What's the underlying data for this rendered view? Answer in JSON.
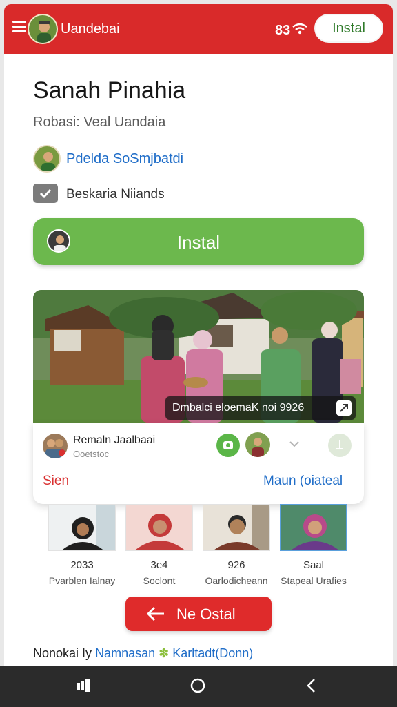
{
  "header": {
    "app_name": "Uandebai",
    "status_text": "83",
    "install_label": "Instal",
    "icons": {
      "menu": "hamburger-icon",
      "wifi": "wifi-icon"
    }
  },
  "app": {
    "title": "Sanah Pinahia",
    "subtitle": "Robasi: Veal Uandaia",
    "developer": "Pdelda SoSmjbatdi",
    "category": "Beskaria Niiands"
  },
  "install_button": {
    "label": "Instal"
  },
  "photo": {
    "caption": "Dmbalci eloemaK noi 9926"
  },
  "post": {
    "name": "Remaln Jaalbaai",
    "subtext": "Ooetstoc",
    "left_action": "Sien",
    "right_action": "Maun (oiateal"
  },
  "people": [
    {
      "value": "2033",
      "label": "Pvarblen Ialnay"
    },
    {
      "value": "3e4",
      "label": "Soclont"
    },
    {
      "value": "926",
      "label": "Oarlodicheann"
    },
    {
      "value": "Saal",
      "label": "Stapeal Urafies"
    }
  ],
  "action_button": {
    "label": "Ne Ostal"
  },
  "footer": {
    "prefix": "Nonokai Iy",
    "middle": "Namnasan",
    "suffix": "Karltadt(Donn)"
  },
  "colors": {
    "brand_red": "#d92a2a",
    "install_green": "#6cb84d",
    "link_blue": "#1f6dc8"
  }
}
